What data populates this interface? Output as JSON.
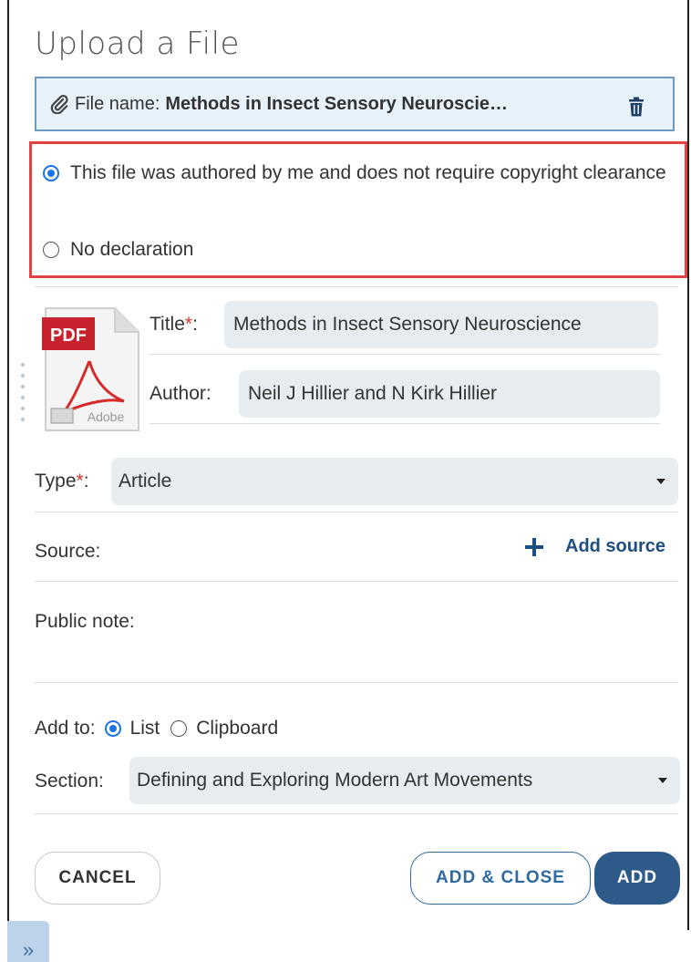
{
  "header": {
    "title": "Upload a File"
  },
  "file": {
    "label": "File name:",
    "value": "Methods in Insect Sensory Neuroscie…"
  },
  "declaration": {
    "options": [
      {
        "label": "This file was authored by me and does not require copyright clearance",
        "checked": true
      },
      {
        "label": "No declaration",
        "checked": false
      }
    ]
  },
  "thumbnail": {
    "badge": "PDF",
    "brand": "Adobe"
  },
  "fields": {
    "title_label": "Title",
    "title_value": "Methods in Insect Sensory Neuroscience",
    "author_label": "Author:",
    "author_value": "Neil J Hillier and N Kirk Hillier",
    "type_label": "Type",
    "type_value": "Article",
    "source_label": "Source:",
    "add_source": "Add source",
    "public_note_label": "Public note:",
    "required_mark": "*",
    "colon": ":"
  },
  "add_to": {
    "label": "Add to:",
    "options": [
      {
        "label": "List",
        "checked": true
      },
      {
        "label": "Clipboard",
        "checked": false
      }
    ]
  },
  "section": {
    "label": "Section:",
    "value": "Defining and Exploring Modern Art Movements"
  },
  "buttons": {
    "cancel": "CANCEL",
    "add_close": "ADD & CLOSE",
    "add": "ADD"
  },
  "expand": {
    "glyph": "»"
  },
  "colors": {
    "accent": "#1a73e8",
    "primary_button": "#2d5a88",
    "highlight_border": "#e04343",
    "input_bg": "#e6ecef"
  }
}
